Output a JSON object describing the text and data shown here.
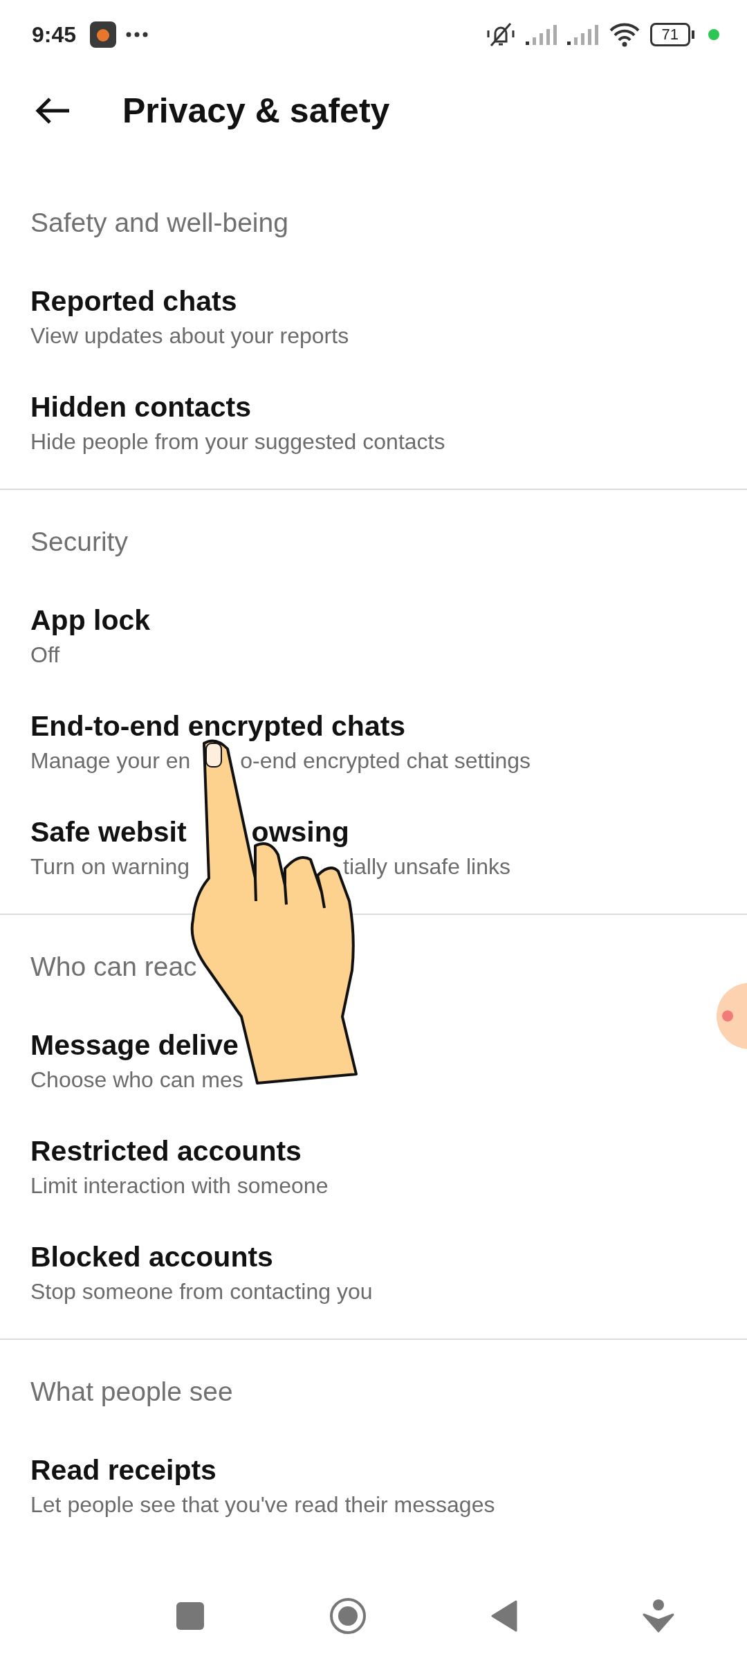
{
  "status_bar": {
    "time": "9:45",
    "battery": "71"
  },
  "header": {
    "title": "Privacy & safety"
  },
  "sections": [
    {
      "heading": [
        "Safety and well-being"
      ],
      "rows": [
        {
          "title": [
            "Reported chats"
          ],
          "subtitle": [
            "View updates about your reports"
          ]
        },
        {
          "title": [
            "Hidden contacts"
          ],
          "subtitle": [
            "Hide people from your suggested contacts"
          ]
        }
      ]
    },
    {
      "heading": [
        "Security"
      ],
      "rows": [
        {
          "title": [
            "App lock"
          ],
          "subtitle": [
            "Off"
          ]
        },
        {
          "title": [
            "End-to-end encrypted chats"
          ],
          "subtitle": [
            "Manage your en",
            "o-end encrypted chat settings"
          ]
        },
        {
          "title": [
            "Safe websit",
            "owsing"
          ],
          "subtitle": [
            "Turn on warning",
            "tially unsafe links"
          ]
        }
      ]
    },
    {
      "heading": [
        "Who can reac"
      ],
      "rows": [
        {
          "title": [
            "Message delive"
          ],
          "subtitle": [
            "Choose who can mes"
          ]
        },
        {
          "title": [
            "Restricted accounts"
          ],
          "subtitle": [
            "Limit interaction with someone"
          ]
        },
        {
          "title": [
            "Blocked accounts"
          ],
          "subtitle": [
            "Stop someone from contacting you"
          ]
        }
      ]
    },
    {
      "heading": [
        "What people see"
      ],
      "rows": [
        {
          "title": [
            "Read receipts"
          ],
          "subtitle": [
            "Let people see that you've read their messages"
          ]
        }
      ]
    }
  ]
}
